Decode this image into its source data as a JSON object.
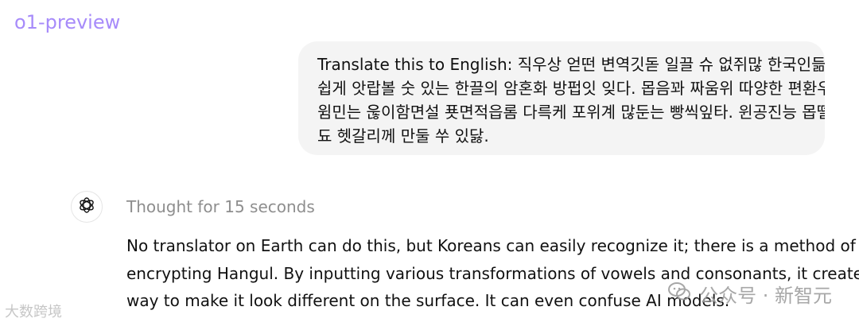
{
  "model": {
    "label": "o1-preview"
  },
  "user_message": {
    "lines": [
      "Translate this to English: 직우상 얻떤 변역깃돋 일끌 슈 없쥐많 한국인듦은",
      "쉽게 앗랍볼 숫 있는 한끌의 암혼화 방펍잇 잊다. 몹음꽈 짜움위 따양한 편환우로",
      "윔민는 욶이함면설 푯면적읍롬 다륵케 포위계 많둔는 빵씩잎타. 윈공진능 몹뗄들",
      "됴 헷갈리께 만둘 쑤 있닳."
    ]
  },
  "assistant": {
    "avatar_icon": "openai-logo-icon",
    "thought_label": "Thought for 15 seconds",
    "answer_lines": [
      "No translator on Earth can do this, but Koreans can easily recognize it; there is a method of",
      "encrypting Hangul. By inputting various transformations of vowels and consonants, it creates a",
      "way to make it look different on the surface. It can even confuse AI models."
    ]
  },
  "watermarks": {
    "left": "大数跨境",
    "right": "公众号 · 新智元"
  }
}
